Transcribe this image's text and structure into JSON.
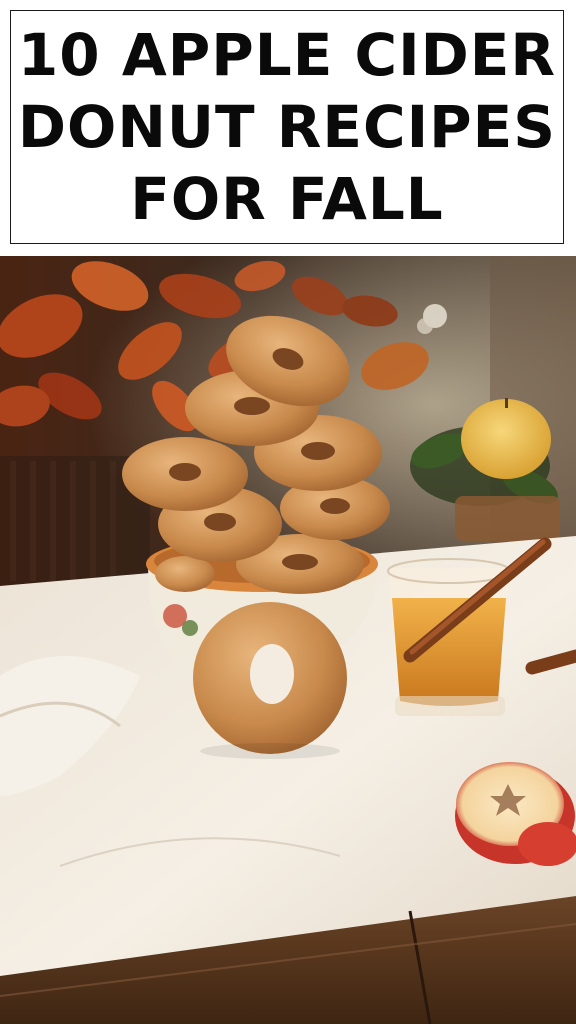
{
  "pin": {
    "title": "10 APPLE CIDER\nDONUT RECIPES\nFOR FALL"
  },
  "photo": {
    "subject": "donut-stack-with-apple-cider"
  }
}
